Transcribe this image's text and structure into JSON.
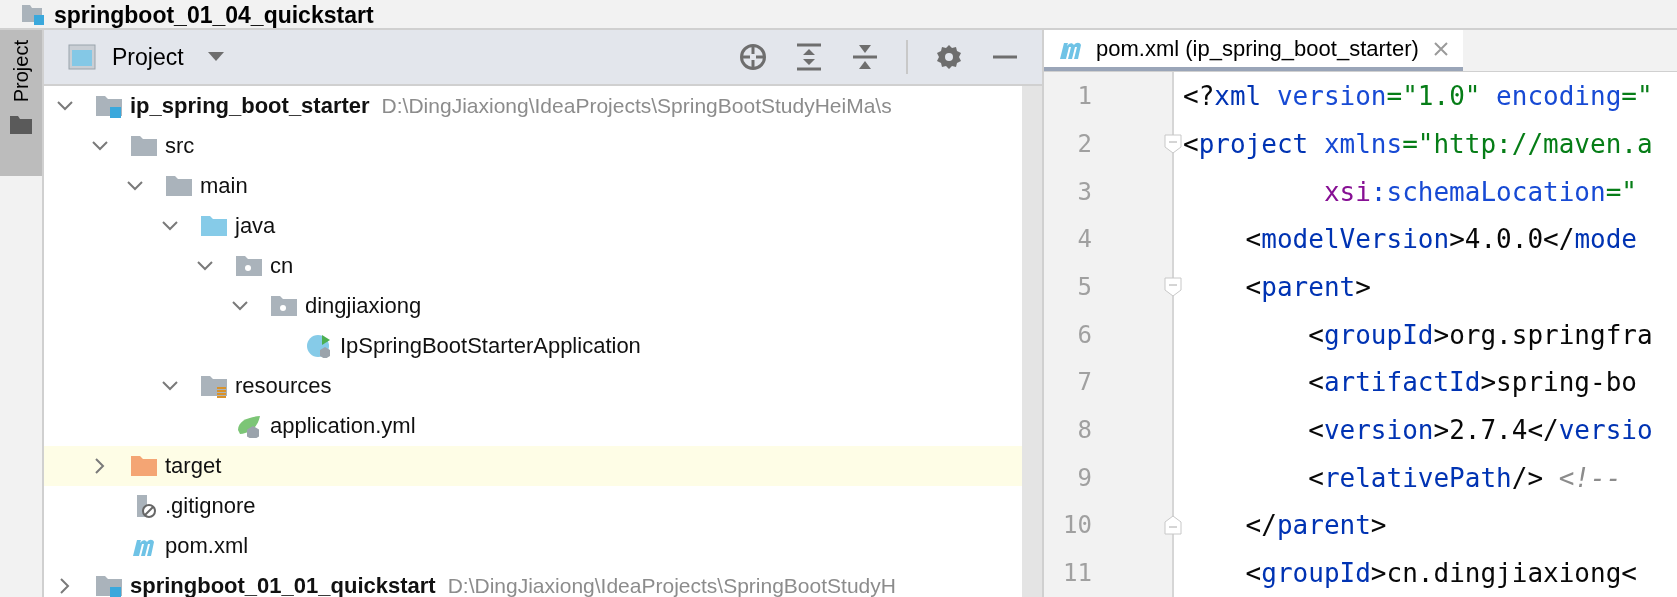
{
  "window": {
    "title": "springboot_01_04_quickstart"
  },
  "tool_strip": {
    "label": "Project",
    "selected": true
  },
  "project_panel": {
    "title": "Project"
  },
  "tree": [
    {
      "name": "ip_spring_boot_starter",
      "kind": "module",
      "path": "D:\\DingJiaxiong\\IdeaProjects\\SpringBootStudyHeiMa\\s",
      "expanded": true,
      "selected": false,
      "children": [
        {
          "name": "src",
          "kind": "folder",
          "expanded": true,
          "selected": false,
          "children": [
            {
              "name": "main",
              "kind": "folder",
              "expanded": true,
              "selected": false,
              "children": [
                {
                  "name": "java",
                  "kind": "source_folder",
                  "expanded": true,
                  "selected": false,
                  "children": [
                    {
                      "name": "cn",
                      "kind": "package",
                      "expanded": true,
                      "selected": false,
                      "children": [
                        {
                          "name": "dingjiaxiong",
                          "kind": "package",
                          "expanded": true,
                          "selected": false,
                          "children": [
                            {
                              "name": "IpSpringBootStarterApplication",
                              "kind": "spring_class",
                              "selected": false
                            }
                          ]
                        }
                      ]
                    }
                  ]
                },
                {
                  "name": "resources",
                  "kind": "resources_folder",
                  "expanded": true,
                  "selected": false,
                  "children": [
                    {
                      "name": "application.yml",
                      "kind": "spring_config",
                      "selected": false
                    }
                  ]
                }
              ]
            }
          ]
        },
        {
          "name": "target",
          "kind": "excluded_folder",
          "expanded": false,
          "selected": true
        },
        {
          "name": ".gitignore",
          "kind": "ignore_file",
          "selected": false
        },
        {
          "name": "pom.xml",
          "kind": "maven_file",
          "selected": false
        }
      ]
    },
    {
      "name": "springboot_01_01_quickstart",
      "kind": "module",
      "path": "D:\\DingJiaxiong\\IdeaProjects\\SpringBootStudyH",
      "expanded": false,
      "selected": false
    }
  ],
  "editor": {
    "tab": {
      "title": "pom.xml (ip_spring_boot_starter)",
      "selected": true
    },
    "lines": [
      {
        "number": "1",
        "kind": "plain",
        "tokens": [
          {
            "kind": "punct",
            "text": "<?"
          },
          {
            "kind": "tag",
            "text": "xml"
          },
          {
            "kind": "attr",
            "text": " version"
          },
          {
            "kind": "str",
            "text": "=\"1.0\""
          },
          {
            "kind": "attr",
            "text": " encoding"
          },
          {
            "kind": "str",
            "text": "=\""
          }
        ]
      },
      {
        "number": "2",
        "kind": "fold_start",
        "tokens": [
          {
            "kind": "punct",
            "text": "<"
          },
          {
            "kind": "tag",
            "text": "project"
          },
          {
            "kind": "attr",
            "text": " xmlns"
          },
          {
            "kind": "str",
            "text": "=\"http://maven.a"
          }
        ]
      },
      {
        "number": "3",
        "kind": "plain",
        "tokens": [
          {
            "kind": "ns",
            "text": "         xsi"
          },
          {
            "kind": "attr",
            "text": ":schemaLocation"
          },
          {
            "kind": "str",
            "text": "=\""
          }
        ]
      },
      {
        "number": "4",
        "kind": "plain",
        "tokens": [
          {
            "kind": "punct",
            "text": "    <"
          },
          {
            "kind": "tag",
            "text": "modelVersion"
          },
          {
            "kind": "punct",
            "text": ">"
          },
          {
            "kind": "text",
            "text": "4.0.0"
          },
          {
            "kind": "punct",
            "text": "</"
          },
          {
            "kind": "tag",
            "text": "mode"
          }
        ]
      },
      {
        "number": "5",
        "kind": "fold_start",
        "tokens": [
          {
            "kind": "punct",
            "text": "    <"
          },
          {
            "kind": "tag",
            "text": "parent"
          },
          {
            "kind": "punct",
            "text": ">"
          }
        ]
      },
      {
        "number": "6",
        "kind": "plain",
        "tokens": [
          {
            "kind": "punct",
            "text": "        <"
          },
          {
            "kind": "tag",
            "text": "groupId"
          },
          {
            "kind": "punct",
            "text": ">"
          },
          {
            "kind": "text",
            "text": "org.springfra"
          }
        ]
      },
      {
        "number": "7",
        "kind": "plain",
        "tokens": [
          {
            "kind": "punct",
            "text": "        <"
          },
          {
            "kind": "tag",
            "text": "artifactId"
          },
          {
            "kind": "punct",
            "text": ">"
          },
          {
            "kind": "text",
            "text": "spring-bo"
          }
        ]
      },
      {
        "number": "8",
        "kind": "plain",
        "tokens": [
          {
            "kind": "punct",
            "text": "        <"
          },
          {
            "kind": "tag",
            "text": "version"
          },
          {
            "kind": "punct",
            "text": ">"
          },
          {
            "kind": "text",
            "text": "2.7.4"
          },
          {
            "kind": "punct",
            "text": "</"
          },
          {
            "kind": "tag",
            "text": "versio"
          }
        ]
      },
      {
        "number": "9",
        "kind": "plain",
        "tokens": [
          {
            "kind": "punct",
            "text": "        <"
          },
          {
            "kind": "tag",
            "text": "relativePath"
          },
          {
            "kind": "punct",
            "text": "/> "
          },
          {
            "kind": "comment",
            "text": "<!--"
          }
        ]
      },
      {
        "number": "10",
        "kind": "fold_end",
        "tokens": [
          {
            "kind": "punct",
            "text": "    </"
          },
          {
            "kind": "tag",
            "text": "parent"
          },
          {
            "kind": "punct",
            "text": ">"
          }
        ]
      },
      {
        "number": "11",
        "kind": "plain",
        "tokens": [
          {
            "kind": "punct",
            "text": "    <"
          },
          {
            "kind": "tag",
            "text": "groupId"
          },
          {
            "kind": "punct",
            "text": ">"
          },
          {
            "kind": "text",
            "text": "cn.dingjiaxiong"
          },
          {
            "kind": "punct",
            "text": "<"
          }
        ]
      }
    ]
  }
}
